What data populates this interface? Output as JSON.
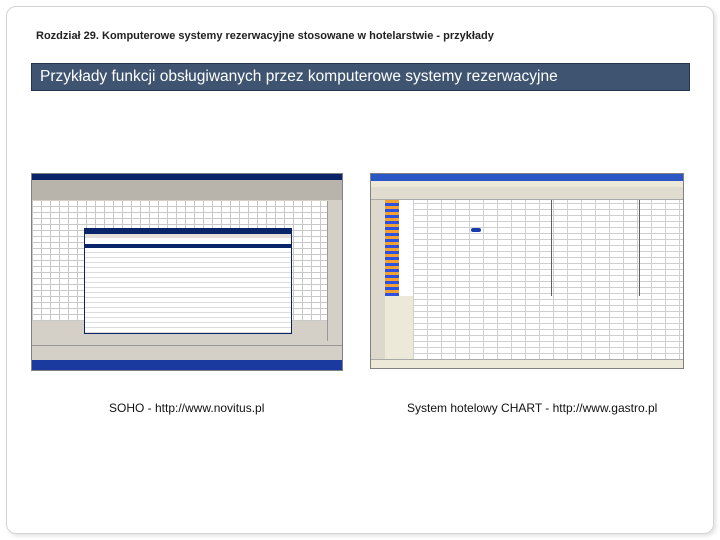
{
  "header": {
    "chapter": "Rozdział 29. Komputerowe systemy rezerwacyjne stosowane w hotelarstwie - przykłady",
    "title": "Przykłady funkcji obsługiwanych przez komputerowe systemy rezerwacyjne"
  },
  "colors": {
    "banner": "#3e5470",
    "banner_text": "#ffffff"
  },
  "screenshots": [
    {
      "caption": "SOHO - http://www.novitus.pl"
    },
    {
      "caption": "System hotelowy CHART - http://www.gastro.pl"
    }
  ]
}
